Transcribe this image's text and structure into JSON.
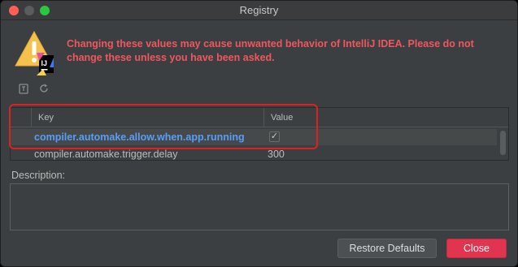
{
  "window": {
    "title": "Registry"
  },
  "warning": {
    "text": "Changing these values may cause unwanted behavior of IntelliJ IDEA. Please do not change these unless you have been asked.",
    "icon_badge": "IJ"
  },
  "toolbar": {
    "export_icon": "export-icon",
    "refresh_icon": "refresh-icon"
  },
  "table": {
    "headers": {
      "key": "Key",
      "value": "Value"
    },
    "rows": [
      {
        "key": "compiler.automake.allow.when.app.running",
        "value": "✓",
        "type": "checkbox",
        "checked": true
      },
      {
        "key": "compiler.automake.trigger.delay",
        "value": "300",
        "type": "text"
      }
    ]
  },
  "description": {
    "label": "Description:",
    "value": ""
  },
  "buttons": {
    "restore": "Restore Defaults",
    "close": "Close"
  },
  "colors": {
    "warning": "#f0565e",
    "accent_key": "#589df6",
    "close_button": "#e0344f",
    "highlight": "#e02020"
  }
}
